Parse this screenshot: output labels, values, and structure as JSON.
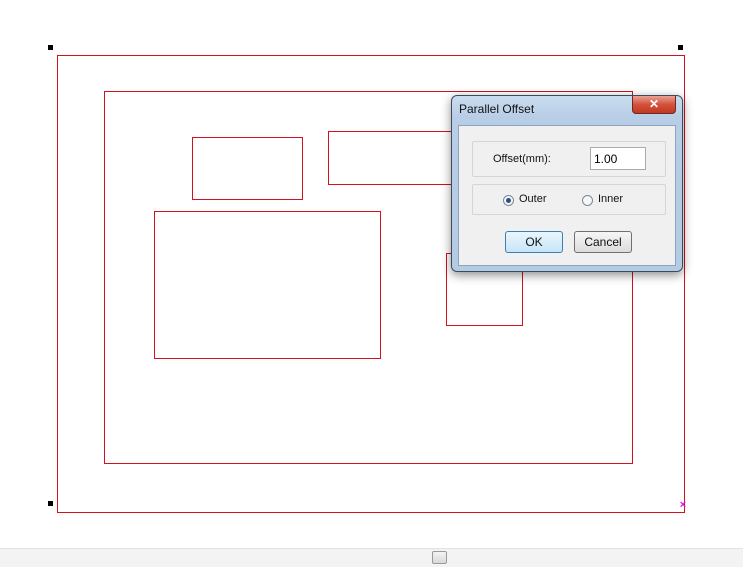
{
  "dialog": {
    "title": "Parallel Offset",
    "close_symbol": "✕",
    "offset_label": "Offset(mm):",
    "offset_value": "1.00",
    "outer_label": "Outer",
    "inner_label": "Inner",
    "selected_mode": "Outer",
    "ok_label": "OK",
    "cancel_label": "Cancel"
  },
  "canvas": {
    "shape_color": "#d2101e",
    "origin_marker": "×",
    "origin_color": "#e010e0"
  }
}
